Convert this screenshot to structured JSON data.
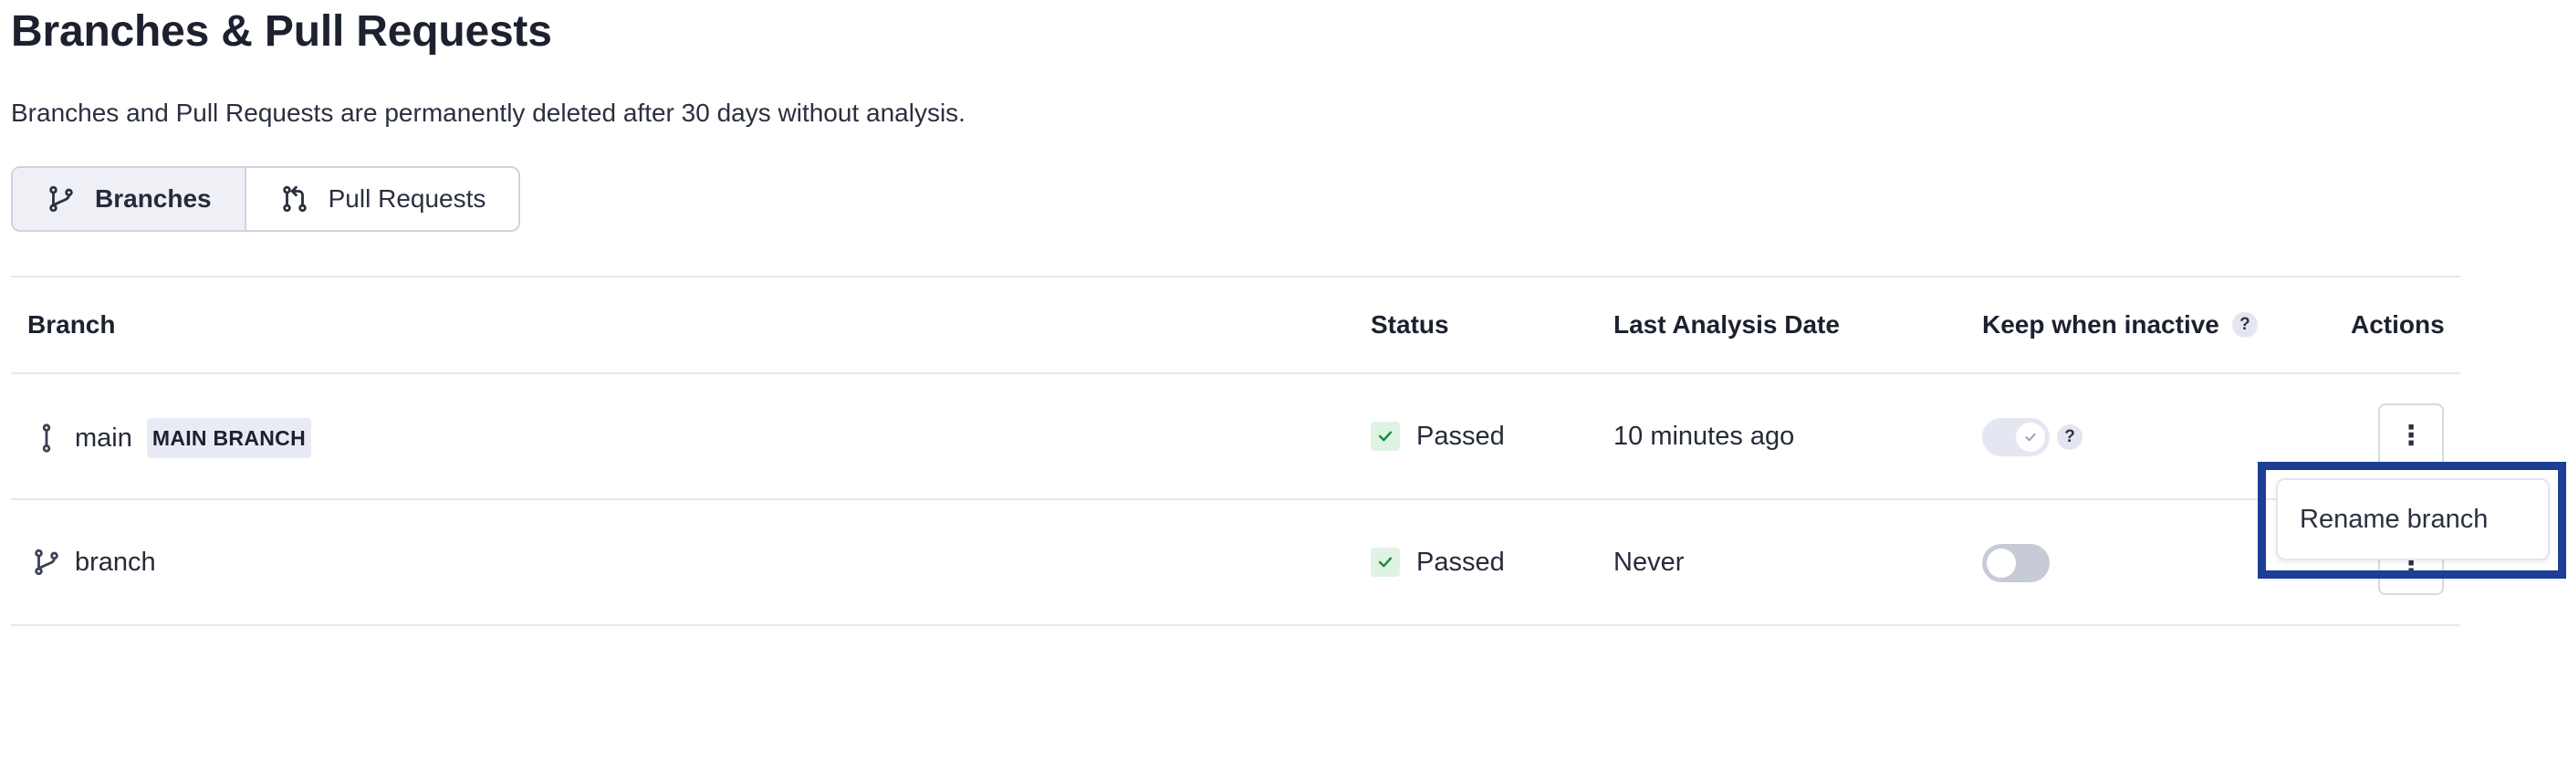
{
  "header": {
    "title": "Branches & Pull Requests",
    "subtitle": "Branches and Pull Requests are permanently deleted after 30 days without analysis."
  },
  "toggle": {
    "items": [
      {
        "label": "Branches",
        "icon": "branch-icon",
        "active": true
      },
      {
        "label": "Pull Requests",
        "icon": "pull-request-icon",
        "active": false
      }
    ]
  },
  "table": {
    "columns": {
      "branch": "Branch",
      "status": "Status",
      "last_analysis": "Last Analysis Date",
      "keep_inactive": "Keep when inactive",
      "actions": "Actions"
    },
    "help_glyph": "?",
    "rows": [
      {
        "name": "main",
        "badge": "MAIN BRANCH",
        "status": "Passed",
        "last_analysis": "10 minutes ago",
        "keep_inactive": true,
        "keep_help": "?",
        "actions_glyph": "⋮"
      },
      {
        "name": "branch",
        "badge": "",
        "status": "Passed",
        "last_analysis": "Never",
        "keep_inactive": false,
        "actions_glyph": "⋮"
      }
    ]
  },
  "menu": {
    "items": [
      "Rename branch"
    ]
  },
  "colors": {
    "accent": "#1c3f95",
    "passed_bg": "#dff3e4",
    "passed_check": "#1f8a3b"
  }
}
